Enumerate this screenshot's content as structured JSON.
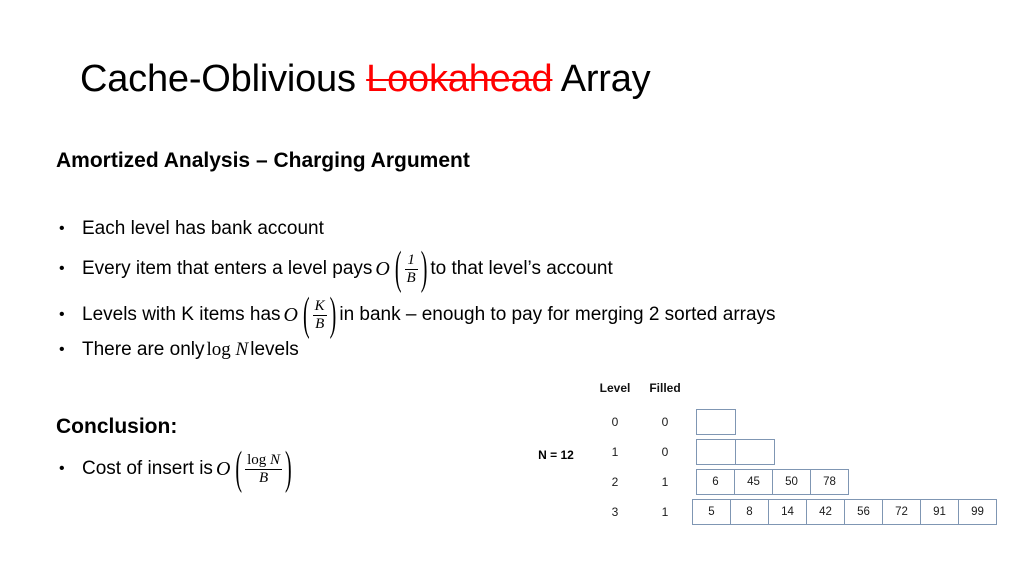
{
  "slide": {
    "title": {
      "before": "Cache-Oblivious ",
      "struck": "Lookahead",
      "after": " Array",
      "struck_color": "#ff0000"
    },
    "heading_amortized": "Amortized Analysis – Charging Argument",
    "heading_conclusion": "Conclusion:",
    "bullet_marker": "•",
    "bullets": [
      {
        "id": "bullet-1",
        "text": "Each level has bank account"
      },
      {
        "id": "bullet-2",
        "pre": "Every item that enters a level pays",
        "formula": {
          "symbol": "O",
          "numerator": "1",
          "denominator": "B"
        },
        "post": "to that level’s account"
      },
      {
        "id": "bullet-3",
        "pre": "Levels with K items has",
        "formula": {
          "symbol": "O",
          "numerator": "K",
          "denominator": "B"
        },
        "post": "in bank – enough to pay for merging 2 sorted arrays"
      },
      {
        "id": "bullet-4",
        "pre": "There are only",
        "inline_math": "log N",
        "post": "levels"
      },
      {
        "id": "bullet-conclusion",
        "pre": "Cost of insert is",
        "formula": {
          "symbol": "O",
          "numerator_log": "log",
          "numerator_var": "N",
          "denominator": "B"
        },
        "post": ""
      }
    ]
  },
  "diagram": {
    "n_label": "N = 12",
    "header_level": "Level",
    "header_filled": "Filled",
    "border_color": "#7f96b3",
    "rows": [
      {
        "level": "0",
        "filled": "0",
        "cells": [
          "",
          ""
        ]
      },
      {
        "level": "1",
        "filled": "0",
        "cells": [
          "",
          ""
        ]
      },
      {
        "level": "2",
        "filled": "1",
        "cells": [
          "6",
          "45",
          "50",
          "78"
        ]
      },
      {
        "level": "3",
        "filled": "1",
        "cells": [
          "5",
          "8",
          "14",
          "42",
          "56",
          "72",
          "91",
          "99"
        ]
      }
    ],
    "row_cell_counts": [
      1,
      2,
      4,
      8
    ]
  }
}
